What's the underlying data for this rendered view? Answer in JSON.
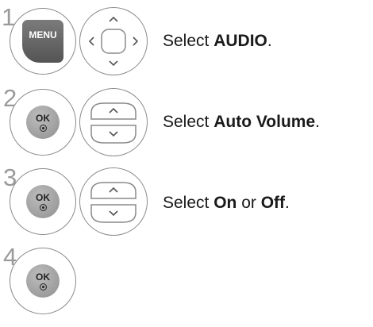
{
  "steps": [
    {
      "number": "1",
      "key_label": "MENU",
      "nav_icon": "four-way-arrow-pad",
      "text_prefix": "Select ",
      "text_bold": "AUDIO",
      "text_suffix": "."
    },
    {
      "number": "2",
      "key_label": "OK",
      "nav_icon": "up-down-arrow-pad",
      "text_prefix": "Select ",
      "text_bold": "Auto Volume",
      "text_suffix": "."
    },
    {
      "number": "3",
      "key_label": "OK",
      "nav_icon": "up-down-arrow-pad",
      "text_prefix": "Select ",
      "text_bold": "On",
      "text_middle": " or ",
      "text_bold2": "Off",
      "text_suffix": "."
    },
    {
      "number": "4",
      "key_label": "OK"
    }
  ],
  "colors": {
    "step_number": "#9a9a9a",
    "key_fill": "#6a6a6a",
    "outline": "#8a8a8a"
  }
}
